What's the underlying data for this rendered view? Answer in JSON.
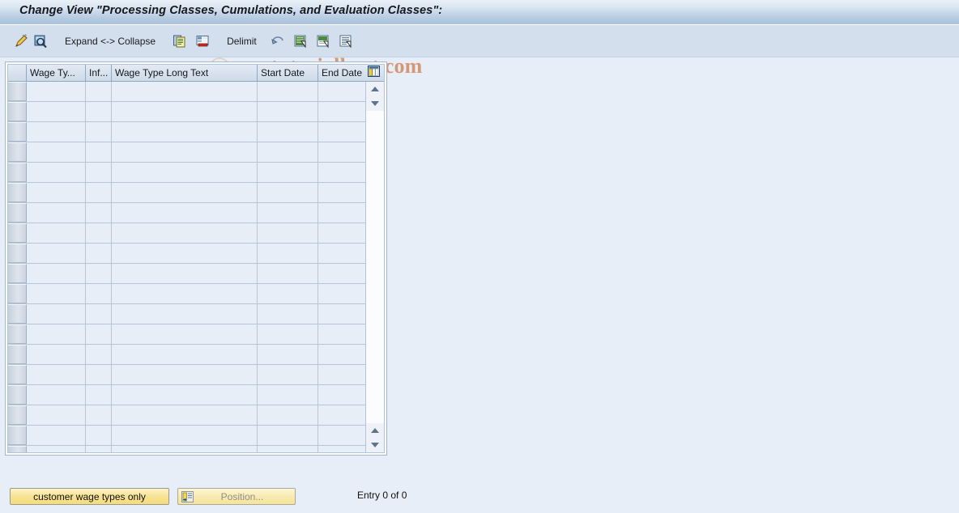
{
  "window": {
    "title": "Change View \"Processing Classes, Cumulations, and Evaluation Classes\":"
  },
  "toolbar": {
    "display_change_icon": "pencil-wand-icon",
    "details_icon": "magnifier-document-icon",
    "expand_collapse_label": "Expand <-> Collapse",
    "copy_icon": "copy-as-icon",
    "delete_icon": "delete-row-icon",
    "delimit_label": "Delimit",
    "undo_icon": "undo-arrow-icon",
    "select_all_icon": "select-all-icon",
    "deselect_all_icon": "deselect-all-icon",
    "select_block_icon": "select-block-icon"
  },
  "watermark": {
    "text": "www.tutorialkart.com"
  },
  "grid": {
    "columns": [
      {
        "key": "select",
        "label": ""
      },
      {
        "key": "wage_type",
        "label": "Wage Ty..."
      },
      {
        "key": "infotype",
        "label": "Inf..."
      },
      {
        "key": "long_text",
        "label": "Wage Type Long Text"
      },
      {
        "key": "start_date",
        "label": "Start Date"
      },
      {
        "key": "end_date",
        "label": "End Date"
      }
    ],
    "config_icon": "table-settings-icon",
    "row_count": 19,
    "rows": [],
    "scroll": {
      "up_icon": "scroll-up-arrow-icon",
      "down_icon": "scroll-down-arrow-icon"
    }
  },
  "footer": {
    "customer_wage_types_label": "customer wage types only",
    "position_label": "Position...",
    "position_icon": "position-icon",
    "entry_status": "Entry 0 of 0"
  },
  "colors": {
    "background": "#e8eef7",
    "toolbar": "#d3dfed",
    "title_gradient_start": "#e9f0f8",
    "title_gradient_end": "#a9c1dc",
    "grid_cell": "#e8eef7",
    "grid_line": "#b6c6d8",
    "button_yellow": "#f7e394",
    "watermark": "#c8642a"
  }
}
